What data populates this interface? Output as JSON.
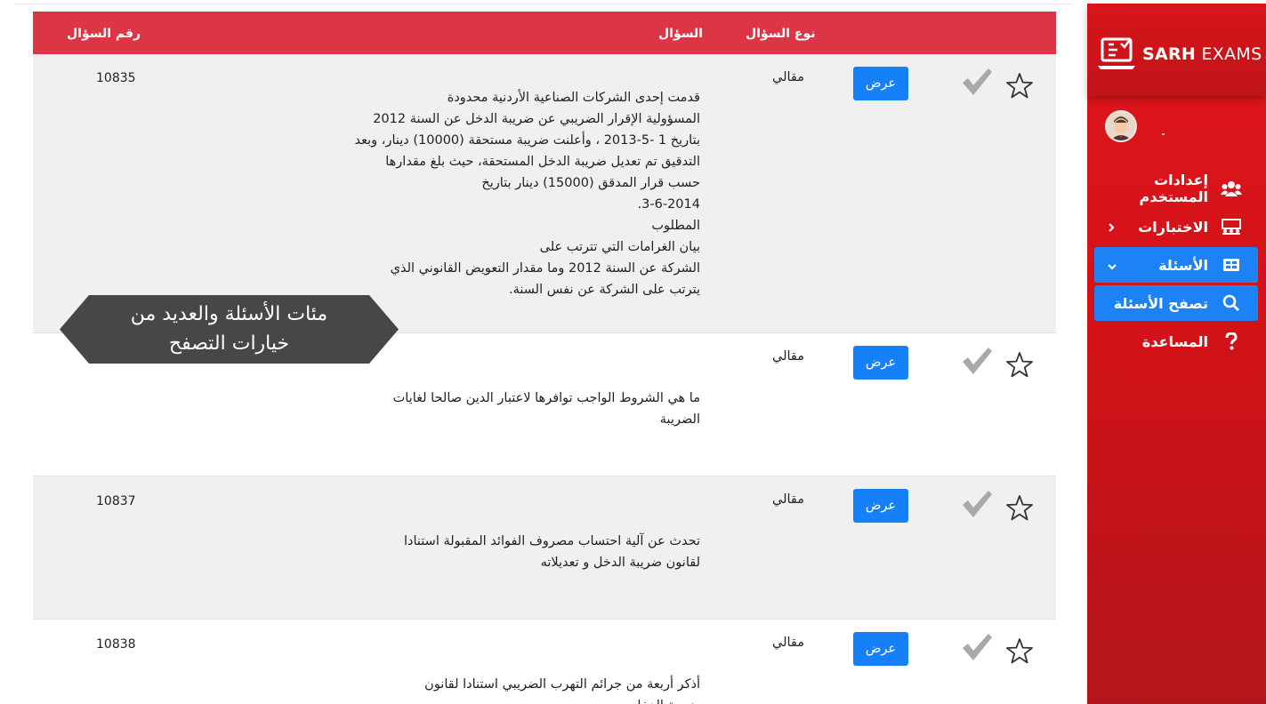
{
  "brand": {
    "name_bold": "SARH",
    "name_light": "EXAMS"
  },
  "colors": {
    "sidebar": "#d31218",
    "header": "#dc3545",
    "button": "#1580f8",
    "active_nav": "#1e82f7",
    "promo": "#474747"
  },
  "sidebar": {
    "items": [
      {
        "label": "إعدادات المستخدم",
        "icon": "users-icon"
      },
      {
        "label": "الاختبارات",
        "icon": "classroom-icon"
      },
      {
        "label": "الأسئلة",
        "icon": "grid-icon"
      },
      {
        "label": "تصفح الأسئلة",
        "icon": "search-icon"
      },
      {
        "label": "المساعدة",
        "icon": "question-icon"
      }
    ]
  },
  "table": {
    "headers": {
      "number": "رقم السؤال",
      "question": "السؤال",
      "type": "نوع السؤال"
    },
    "rows": [
      {
        "number": "10835",
        "type": "مقالي",
        "button": "عرض",
        "lines": [
          "قدمت إحدى الشركات الصناعية الأردنية محدودة",
          "المسؤولية الإقرار الضريبي عن ضريبة الدخل عن السنة 2012",
          "بتاريخ 1 -5-2013 ، وأعلنت ضريبة مستحقة (10000) دينار، وبعد",
          "التدقيق تم تعديل ضريبة الدخل المستحقة، حيث بلغ مقدارها",
          "حسب قرار المدقق (15000) دينار بتاريخ",
          "3-6-2014.",
          "المطلوب",
          "بيان الغرامات التي تترتب على",
          "الشركة عن السنة 2012 وما مقدار التعويض القانوني الذي",
          "يترتب على الشركة عن نفس السنة."
        ]
      },
      {
        "number": "",
        "type": "مقالي",
        "button": "عرض",
        "lines": [
          "ما هي الشروط الواجب توافرها لاعتبار الدين صالحا لغايات",
          "الضريبة"
        ]
      },
      {
        "number": "10837",
        "type": "مقالي",
        "button": "عرض",
        "lines": [
          "تحدث عن آلية احتساب مصروف الفوائد المقبولة استنادا",
          "لقانون ضريبة الدخل و تعديلاته"
        ]
      },
      {
        "number": "10838",
        "type": "مقالي",
        "button": "عرض",
        "lines": [
          "أذكر أربعة من جرائم التهرب الضريبي استنادا لقانون",
          "ضريبة الدخل"
        ]
      }
    ]
  },
  "promo": {
    "line1": "مئات الأسئلة والعديد من",
    "line2": "خيارات التصفح"
  }
}
